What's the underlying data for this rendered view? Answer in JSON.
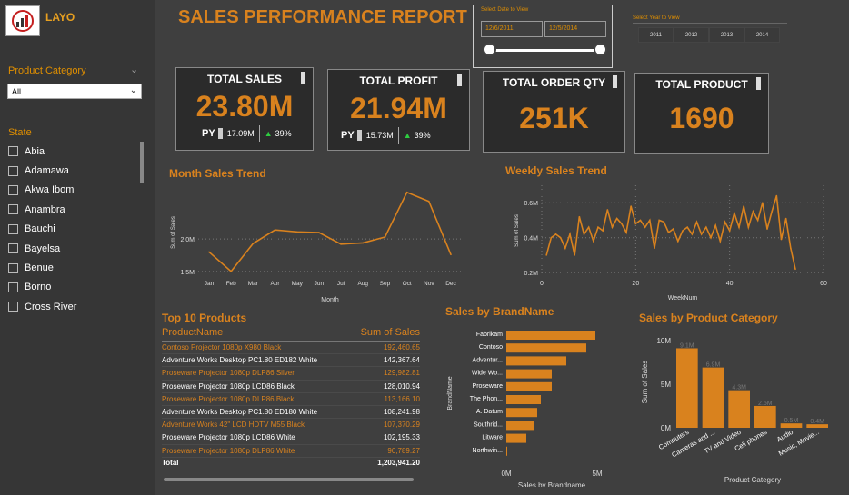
{
  "brand": {
    "name": "LAYO"
  },
  "sidebar": {
    "category_label": "Product Category",
    "category_value": "All",
    "state_label": "State",
    "states": [
      "Abia",
      "Adamawa",
      "Akwa Ibom",
      "Anambra",
      "Bauchi",
      "Bayelsa",
      "Benue",
      "Borno",
      "Cross River"
    ]
  },
  "header": {
    "title": "SALES PERFORMANCE REPORT"
  },
  "date_filter": {
    "label": "Select Date to View",
    "start": "12/6/2011",
    "end": "12/5/2014"
  },
  "year_filter": {
    "label": "Select Year to View",
    "years": [
      "2011",
      "2012",
      "2013",
      "2014"
    ]
  },
  "kpis": {
    "total_sales": {
      "title": "TOTAL SALES",
      "value": "23.80M",
      "py_label": "PY",
      "py_value": "17.09M",
      "change": "39%"
    },
    "total_profit": {
      "title": "TOTAL PROFIT",
      "value": "21.94M",
      "py_label": "PY",
      "py_value": "15.73M",
      "change": "39%"
    },
    "total_order_qty": {
      "title": "TOTAL ORDER QTY",
      "value": "251K"
    },
    "total_product": {
      "title": "TOTAL PRODUCT",
      "value": "1690"
    }
  },
  "month_trend": {
    "title": "Month Sales Trend"
  },
  "weekly_trend": {
    "title": "Weekly Sales Trend"
  },
  "top_products": {
    "title": "Top 10 Products",
    "col_name": "ProductName",
    "col_sales": "Sum of Sales",
    "rows": [
      {
        "name": "Contoso Projector 1080p X980 Black",
        "sales": "192,460.65"
      },
      {
        "name": "Adventure Works Desktop PC1.80 ED182 White",
        "sales": "142,367.64"
      },
      {
        "name": "Proseware Projector 1080p DLP86 Silver",
        "sales": "129,982.81"
      },
      {
        "name": "Proseware Projector 1080p LCD86 Black",
        "sales": "128,010.94"
      },
      {
        "name": "Proseware Projector 1080p DLP86 Black",
        "sales": "113,166.10"
      },
      {
        "name": "Adventure Works Desktop PC1.80 ED180 White",
        "sales": "108,241.98"
      },
      {
        "name": "Adventure Works 42\" LCD HDTV M55 Black",
        "sales": "107,370.29"
      },
      {
        "name": "Proseware Projector 1080p LCD86 White",
        "sales": "102,195.33"
      },
      {
        "name": "Proseware Projector 1080p DLP86 White",
        "sales": "90,789.27"
      }
    ],
    "total_label": "Total",
    "total_value": "1,203,941.20"
  },
  "brand_chart": {
    "title": "Sales by BrandName"
  },
  "category_chart": {
    "title": "Sales by Product Category"
  },
  "chart_data": [
    {
      "type": "line",
      "title": "Month Sales Trend",
      "xlabel": "Month",
      "ylabel": "Sum of Sales",
      "categories": [
        "Jan",
        "Feb",
        "Mar",
        "Apr",
        "May",
        "Jun",
        "Jul",
        "Aug",
        "Sep",
        "Oct",
        "Nov",
        "Dec"
      ],
      "values": [
        1.8,
        1.5,
        1.93,
        2.14,
        2.11,
        2.1,
        1.92,
        1.94,
        2.03,
        2.72,
        2.58,
        1.76
      ],
      "yticks": [
        {
          "v": 1.5,
          "label": "1.5M"
        },
        {
          "v": 2.0,
          "label": "2.0M"
        }
      ],
      "ylim": [
        1.4,
        2.8
      ],
      "color": "#d9821e"
    },
    {
      "type": "line",
      "title": "Weekly Sales Trend",
      "xlabel": "WeekNum",
      "ylabel": "Sum of Sales",
      "x": [
        1,
        2,
        3,
        4,
        5,
        6,
        7,
        8,
        9,
        10,
        11,
        12,
        13,
        14,
        15,
        16,
        17,
        18,
        19,
        20,
        21,
        22,
        23,
        24,
        25,
        26,
        27,
        28,
        29,
        30,
        31,
        32,
        33,
        34,
        35,
        36,
        37,
        38,
        39,
        40,
        41,
        42,
        43,
        44,
        45,
        46,
        47,
        48,
        49,
        50,
        51,
        52,
        53
      ],
      "values": [
        0.3,
        0.4,
        0.42,
        0.4,
        0.34,
        0.42,
        0.3,
        0.52,
        0.42,
        0.46,
        0.38,
        0.46,
        0.44,
        0.56,
        0.46,
        0.51,
        0.48,
        0.43,
        0.58,
        0.48,
        0.5,
        0.46,
        0.5,
        0.34,
        0.5,
        0.49,
        0.43,
        0.45,
        0.38,
        0.44,
        0.46,
        0.42,
        0.49,
        0.42,
        0.46,
        0.4,
        0.47,
        0.38,
        0.49,
        0.44,
        0.54,
        0.46,
        0.58,
        0.46,
        0.55,
        0.5,
        0.6,
        0.45,
        0.55,
        0.64,
        0.39,
        0.51,
        0.34,
        0.22
      ],
      "xticks": [
        0,
        20,
        40,
        60
      ],
      "yticks": [
        {
          "v": 0.2,
          "label": "0.2M"
        },
        {
          "v": 0.4,
          "label": "0.4M"
        },
        {
          "v": 0.6,
          "label": "0.6M"
        }
      ],
      "xlim": [
        0,
        60
      ],
      "ylim": [
        0.18,
        0.7
      ],
      "color": "#d9821e"
    },
    {
      "type": "bar",
      "orientation": "horizontal",
      "title": "Sales by BrandName",
      "xlabel": "Sales by Brandname",
      "ylabel": "BrandName",
      "categories": [
        "Fabrikam",
        "Contoso",
        "Adventur...",
        "Wide Wo...",
        "Proseware",
        "The Phon...",
        "A. Datum",
        "Southrid...",
        "Litware",
        "Northwin..."
      ],
      "values": [
        4.9,
        4.4,
        3.3,
        2.5,
        2.5,
        1.9,
        1.7,
        1.5,
        1.1,
        0.05
      ],
      "xticks": [
        {
          "v": 0,
          "label": "0M"
        },
        {
          "v": 5,
          "label": "5M"
        }
      ],
      "xlim": [
        0,
        5
      ],
      "color": "#d9821e"
    },
    {
      "type": "bar",
      "title": "Sales by Product Category",
      "xlabel": "Product Category",
      "ylabel": "Sum of Sales",
      "categories": [
        "Computers",
        "Cameras and ...",
        "TV and Video",
        "Cell phones",
        "Audio",
        "Music, Movie..."
      ],
      "values": [
        9.1,
        6.9,
        4.3,
        2.5,
        0.5,
        0.4
      ],
      "labels": [
        "9.1M",
        "6.9M",
        "4.3M",
        "2.5M",
        "0.5M",
        "0.4M"
      ],
      "yticks": [
        {
          "v": 0,
          "label": "0M"
        },
        {
          "v": 5,
          "label": "5M"
        },
        {
          "v": 10,
          "label": "10M"
        }
      ],
      "ylim": [
        0,
        10.5
      ],
      "color": "#d9821e"
    }
  ],
  "colors": {
    "accent": "#d9821e",
    "positive": "#2ecc40",
    "bg": "#3f3f3f",
    "panel": "#2b2b2b"
  }
}
